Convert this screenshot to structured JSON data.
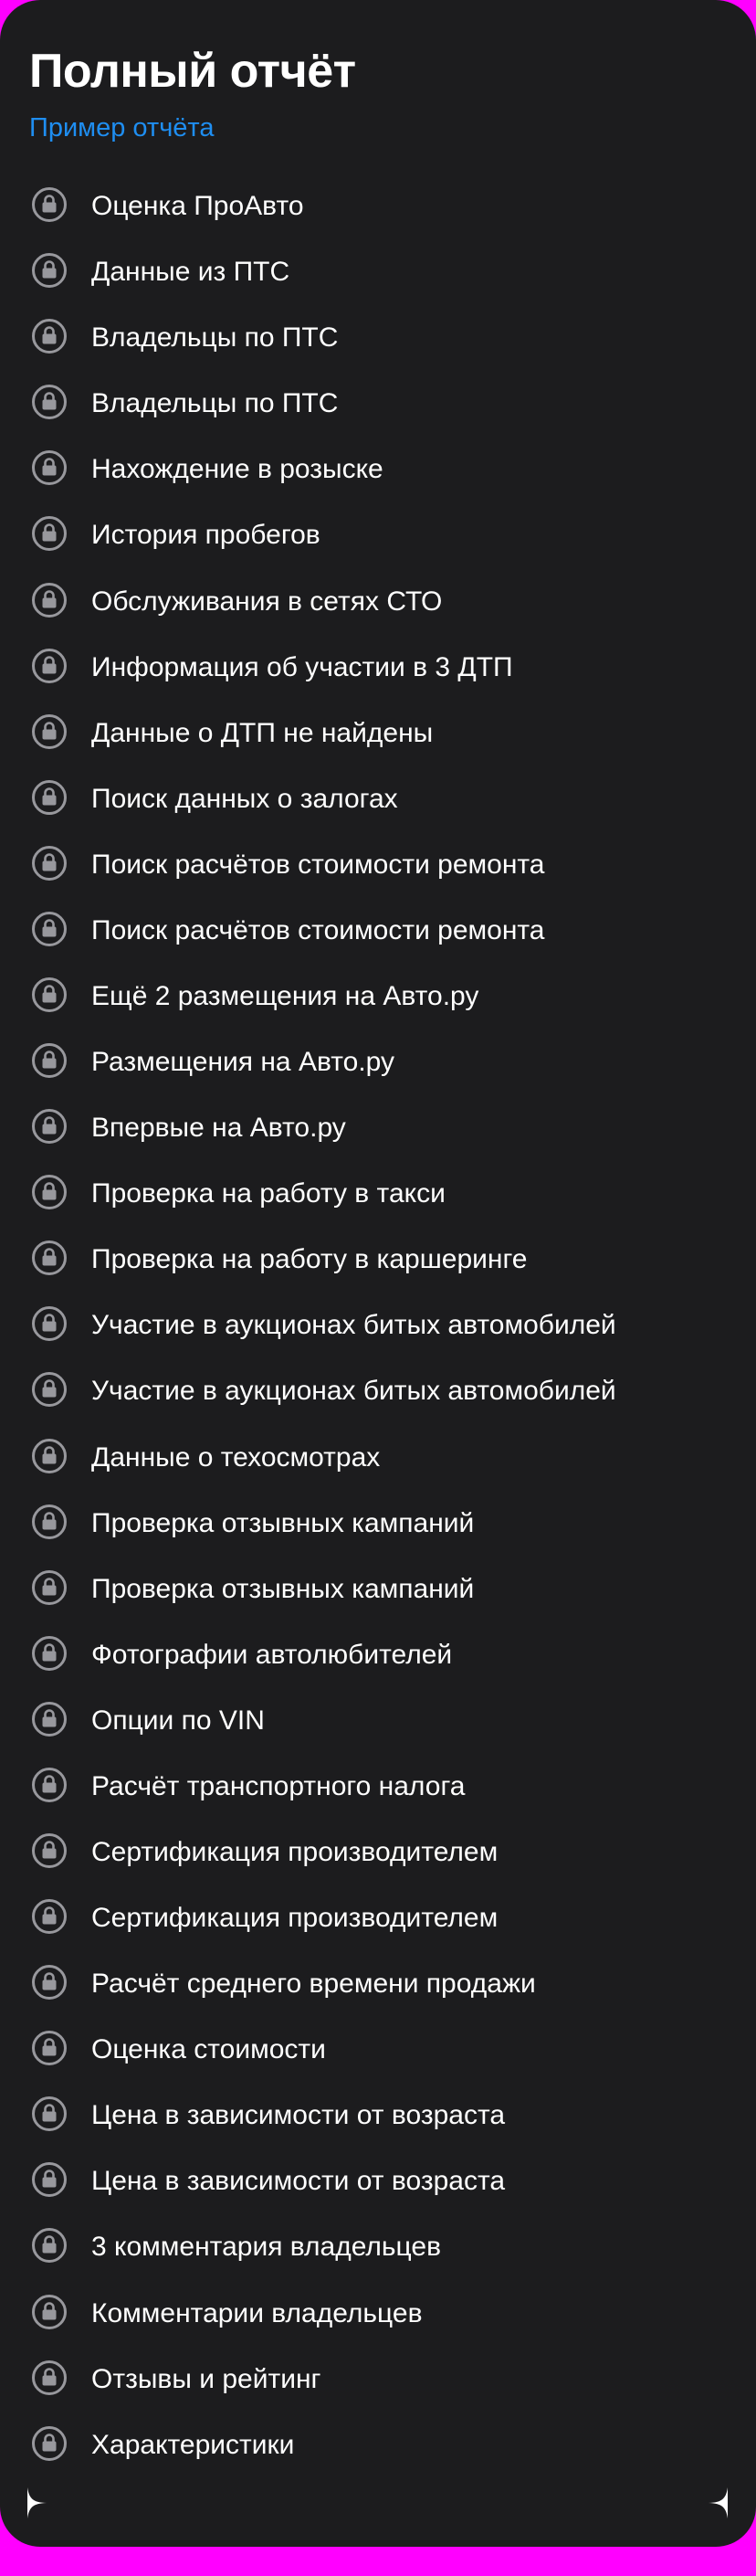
{
  "header": {
    "title": "Полный отчёт",
    "sample_link": "Пример отчёта"
  },
  "colors": {
    "card_background": "#1c1c1e",
    "outer_background": "#ff00ff",
    "link": "#1f8ef1",
    "icon": "#98989d",
    "text": "#ffffff"
  },
  "item_icon": "lock-icon",
  "items": [
    {
      "label": "Оценка ПроАвто"
    },
    {
      "label": "Данные из ПТС"
    },
    {
      "label": "Владельцы по ПТС"
    },
    {
      "label": "Владельцы по ПТС"
    },
    {
      "label": "Нахождение в розыске"
    },
    {
      "label": "История пробегов"
    },
    {
      "label": "Обслуживания в сетях СТО"
    },
    {
      "label": "Информация об участии в 3 ДТП"
    },
    {
      "label": "Данные о ДТП не найдены"
    },
    {
      "label": "Поиск данных о залогах"
    },
    {
      "label": "Поиск расчётов стоимости ремонта"
    },
    {
      "label": "Поиск расчётов стоимости ремонта"
    },
    {
      "label": "Ещё 2 размещения на Авто.ру"
    },
    {
      "label": "Размещения на Авто.ру"
    },
    {
      "label": "Впервые на Авто.ру"
    },
    {
      "label": "Проверка на работу в такси"
    },
    {
      "label": "Проверка на работу в каршеринге"
    },
    {
      "label": "Участие в аукционах битых автомобилей"
    },
    {
      "label": "Участие в аукционах битых автомобилей"
    },
    {
      "label": "Данные о техосмотрах"
    },
    {
      "label": "Проверка отзывных кампаний"
    },
    {
      "label": "Проверка отзывных кампаний"
    },
    {
      "label": "Фотографии автолюбителей"
    },
    {
      "label": "Опции по VIN"
    },
    {
      "label": "Расчёт транспортного налога"
    },
    {
      "label": "Сертификация производителем"
    },
    {
      "label": "Сертификация производителем"
    },
    {
      "label": "Расчёт среднего времени продажи"
    },
    {
      "label": "Оценка стоимости"
    },
    {
      "label": "Цена в зависимости от возраста"
    },
    {
      "label": "Цена в зависимости от возраста"
    },
    {
      "label": "3 комментария владельцев"
    },
    {
      "label": "Комментарии владельцев"
    },
    {
      "label": "Отзывы и рейтинг"
    },
    {
      "label": "Характеристики"
    }
  ]
}
